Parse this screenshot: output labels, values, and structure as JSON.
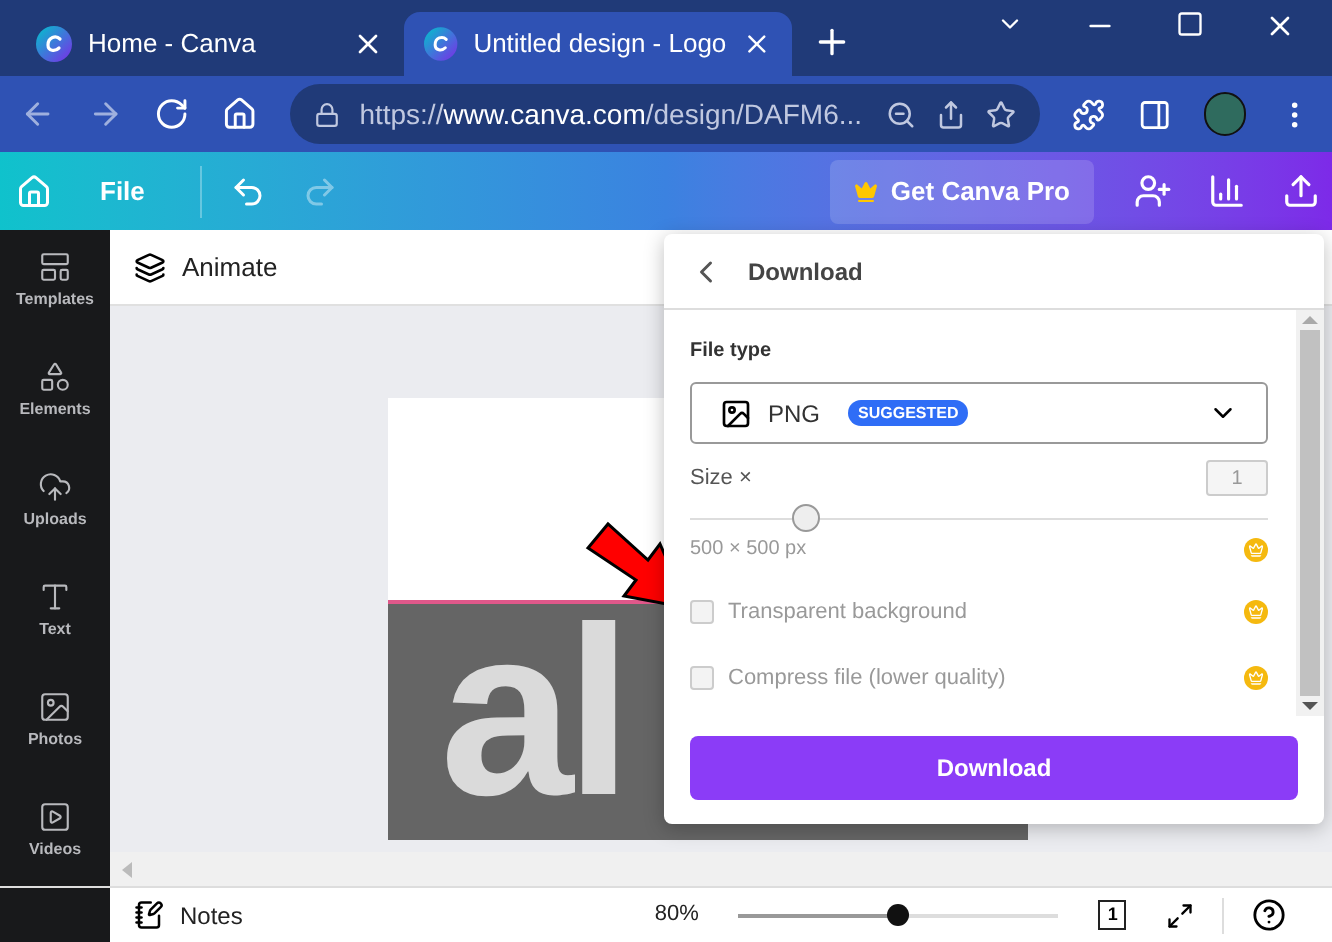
{
  "browser": {
    "tabs": [
      {
        "title": "Home - Canva",
        "selected": false
      },
      {
        "title": "Untitled design - Logo",
        "selected": true
      }
    ],
    "url": {
      "scheme": "https://",
      "host": "www.canva.com",
      "path": "/design/DAFM6..."
    }
  },
  "toolbar": {
    "file": "File",
    "pro_button": "Get Canva Pro"
  },
  "sidebar": {
    "items": [
      {
        "label": "Templates"
      },
      {
        "label": "Elements"
      },
      {
        "label": "Uploads"
      },
      {
        "label": "Text"
      },
      {
        "label": "Photos"
      },
      {
        "label": "Videos"
      }
    ]
  },
  "animate": "Animate",
  "design_text": "al",
  "download_panel": {
    "title": "Download",
    "file_type_label": "File type",
    "file_type": "PNG",
    "badge": "SUGGESTED",
    "size_label": "Size ×",
    "size_value": "1",
    "size_slider": {
      "level": 0.2
    },
    "dimensions": "500 × 500 px",
    "options": [
      {
        "label": "Transparent background",
        "checked": false
      },
      {
        "label": "Compress file (lower quality)",
        "checked": false
      }
    ],
    "button": "Download"
  },
  "bottom_bar": {
    "notes": "Notes",
    "zoom": "80%",
    "zoom_slider": {
      "level": 0.5
    },
    "page_count": "1"
  }
}
